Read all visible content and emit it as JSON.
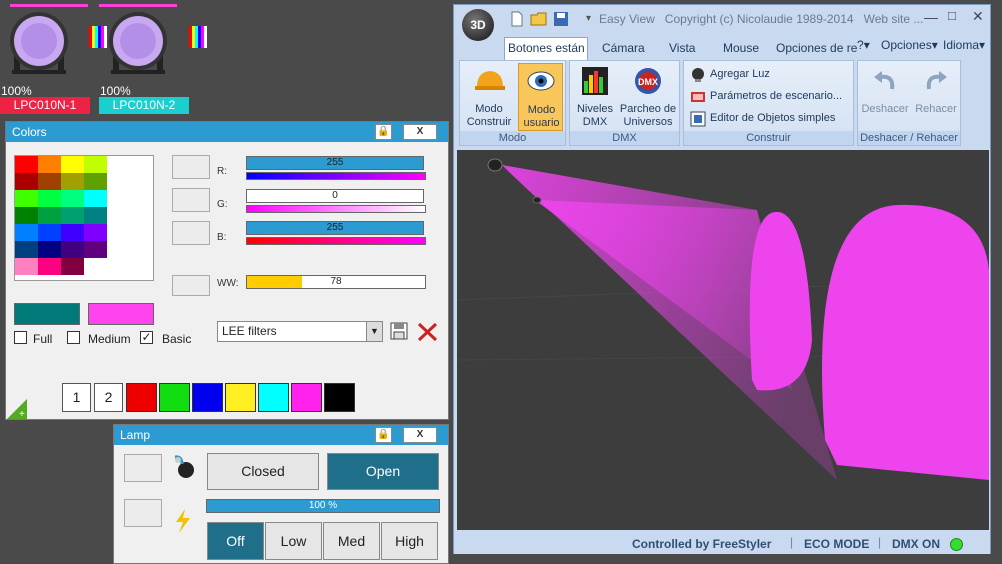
{
  "fixtures": [
    {
      "percent": "100%",
      "name": "LPC010N-1",
      "name_bg": "#ee2244"
    },
    {
      "percent": "100%",
      "name": "LPC010N-2",
      "name_bg": "#1ccfcf"
    }
  ],
  "colors_panel": {
    "title": "Colors",
    "lock_icon": "lock-icon",
    "close_glyph": "X",
    "grid": [
      [
        "#ff0000",
        "#ff8000",
        "#ffff00",
        "#c0ff00"
      ],
      [
        "#aa0000",
        "#a04000",
        "#a0a000",
        "#60a000"
      ],
      [
        "#40ff00",
        "#00ff40",
        "#00ff80",
        "#00ffff"
      ],
      [
        "#008000",
        "#00a040",
        "#00a070",
        "#008080"
      ],
      [
        "#0080ff",
        "#0040ff",
        "#4000ff",
        "#8000ff"
      ],
      [
        "#004080",
        "#000080",
        "#400080",
        "#600080"
      ],
      [
        "#ff80c0",
        "#ff0080",
        "#800040",
        "#ffffff"
      ]
    ],
    "current_color": "#007a78",
    "target_color": "#ff44ee",
    "r": {
      "label": "R:",
      "value": "255",
      "fraction": 1.0
    },
    "g": {
      "label": "G:",
      "value": "0",
      "fraction": 0.0
    },
    "b": {
      "label": "B:",
      "value": "255",
      "fraction": 1.0
    },
    "ww": {
      "label": "WW:",
      "value": "78",
      "fraction": 0.31
    },
    "checks": [
      {
        "label": "Full",
        "checked": false
      },
      {
        "label": "Medium",
        "checked": false
      },
      {
        "label": "Basic",
        "checked": true
      }
    ],
    "filter_select": "LEE filters",
    "pages": [
      "1",
      "2"
    ],
    "quick_colors": [
      "#ee0000",
      "#11dd11",
      "#0000ee",
      "#ffee22",
      "#00ffff",
      "#ff22ee",
      "#000000"
    ]
  },
  "lamp_panel": {
    "title": "Lamp",
    "closed_label": "Closed",
    "open_label": "Open",
    "dimmer_value": "100 %",
    "dimmer_fraction": 1.0,
    "levels": [
      "Off",
      "Low",
      "Med",
      "High"
    ],
    "active_level": "Off"
  },
  "app": {
    "title": "Easy View   Copyright (c) Nicolaudie 1989-2014   Web site ...",
    "badge": "3D",
    "tabs": [
      "Botones están",
      "Cámara",
      "Vista",
      "Mouse",
      "Opciones de re"
    ],
    "right_menu": [
      "?",
      "Opciones",
      "Idioma"
    ],
    "groups": {
      "modo": {
        "name": "Modo",
        "buttons": [
          "Modo\nConstruir",
          "Modo\nusuario"
        ]
      },
      "dmx": {
        "name": "DMX",
        "buttons": [
          "Niveles\nDMX",
          "Parcheo de\nUniversos"
        ]
      },
      "construir": {
        "name": "Construir",
        "items": [
          "Agregar Luz",
          "Parámetros de escenario...",
          "Editor de Objetos simples"
        ]
      },
      "deshacer": {
        "name": "Deshacer / Rehacer",
        "buttons": [
          "Deshacer",
          "Rehacer"
        ]
      }
    },
    "status": [
      "Controlled by FreeStyler",
      "ECO MODE",
      "DMX ON"
    ],
    "status_led": "#33dd33",
    "beam_color": "#ee44ee"
  }
}
